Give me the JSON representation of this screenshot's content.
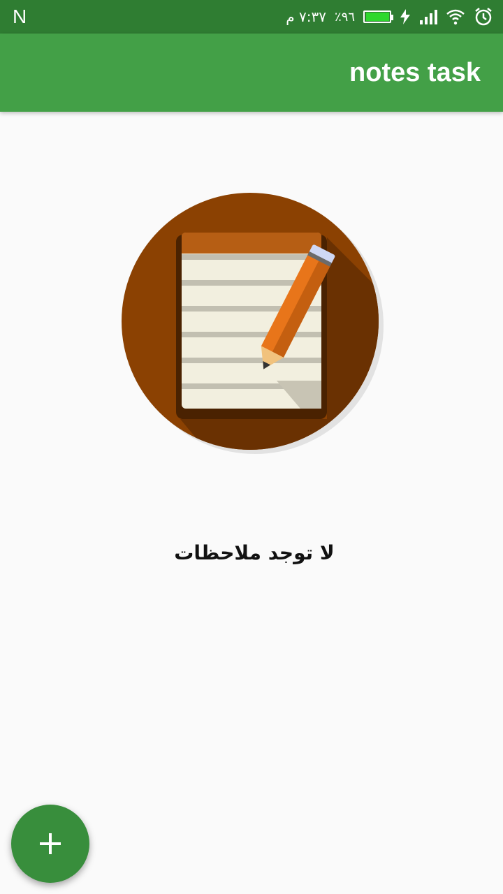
{
  "status_bar": {
    "notification_letter": "N",
    "time": "٧:٣٧ م",
    "battery_percent": "٩٦٪",
    "battery_level": 0.96,
    "icons": [
      "alarm-icon",
      "wifi-icon",
      "signal-icon",
      "charging-icon",
      "battery-icon"
    ]
  },
  "app_bar": {
    "title": "notes task",
    "color": "#43a047"
  },
  "empty_state": {
    "icon": "notepad-pencil-icon",
    "message": "لا توجد ملاحظات"
  },
  "fab": {
    "icon": "plus-icon",
    "color": "#388e3c"
  }
}
